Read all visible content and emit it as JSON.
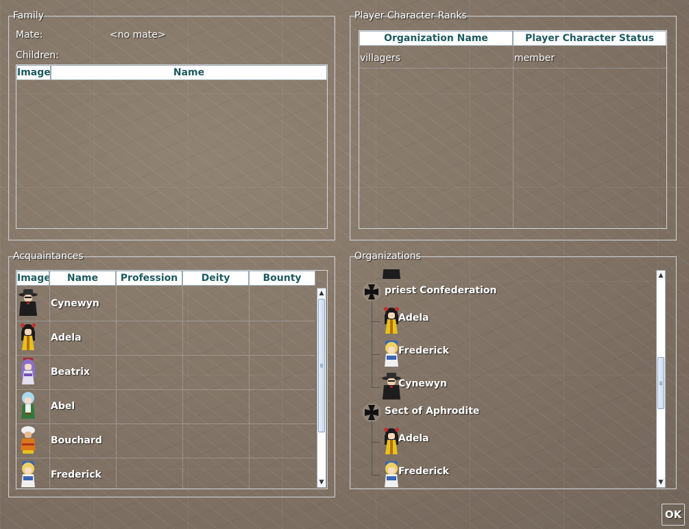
{
  "family": {
    "title": "Family",
    "mate_label": "Mate:",
    "mate_value": "<no mate>",
    "children_label": "Children:",
    "columns": [
      "Image",
      "Name"
    ]
  },
  "ranks": {
    "title": "Player Character Ranks",
    "columns": [
      "Organization Name",
      "Player Character Status"
    ],
    "rows": [
      {
        "organization": "villagers",
        "status": "member"
      }
    ]
  },
  "acquaintances": {
    "title": "Acquaintances",
    "columns": [
      "Image",
      "Name",
      "Profession",
      "Deity",
      "Bounty"
    ],
    "rows": [
      {
        "name": "Cynewyn",
        "portrait": "dark-hat-character-icon"
      },
      {
        "name": "Adela",
        "portrait": "black-hair-yellow-dress-character-icon"
      },
      {
        "name": "Beatrix",
        "portrait": "purple-hair-character-icon"
      },
      {
        "name": "Abel",
        "portrait": "light-blue-hair-character-icon"
      },
      {
        "name": "Bouchard",
        "portrait": "turban-character-icon"
      },
      {
        "name": "Frederick",
        "portrait": "blonde-blue-hat-character-icon"
      }
    ]
  },
  "organizations": {
    "title": "Organizations",
    "groups": [
      {
        "name": "priest Confederation",
        "icon": "iron-cross-icon",
        "members": [
          {
            "name": "Adela",
            "portrait": "black-hair-yellow-dress-character-icon"
          },
          {
            "name": "Frederick",
            "portrait": "blonde-blue-hat-character-icon"
          },
          {
            "name": "Cynewyn",
            "portrait": "dark-hat-character-icon"
          }
        ]
      },
      {
        "name": "Sect of Aphrodite",
        "icon": "iron-cross-icon",
        "members": [
          {
            "name": "Adela",
            "portrait": "black-hair-yellow-dress-character-icon"
          },
          {
            "name": "Frederick",
            "portrait": "blonde-blue-hat-character-icon"
          }
        ]
      }
    ]
  },
  "ok_button": "OK"
}
